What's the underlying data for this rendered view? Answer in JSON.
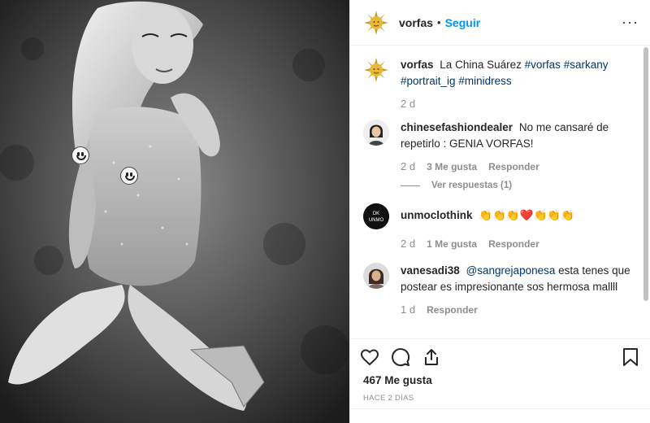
{
  "post": {
    "username": "vorfas",
    "separator": "•",
    "follow_label": "Seguir",
    "more_icon": "more-options-icon"
  },
  "caption": {
    "user": "vorfas",
    "text": "La China Suárez",
    "hashtags": [
      "#vorfas",
      "#sarkany",
      "#portrait_ig",
      "#minidress"
    ],
    "time": "2 d"
  },
  "comments": [
    {
      "user": "chinesefashiondealer",
      "text": "No me cansaré de repetirlo : GENIA VORFAS!",
      "time": "2 d",
      "likes": "3 Me gusta",
      "reply": "Responder",
      "view_replies": "Ver respuestas (1)"
    },
    {
      "user": "unmoclothink",
      "text": "👏👏👏❤️👏👏👏",
      "time": "2 d",
      "likes": "1 Me gusta",
      "reply": "Responder"
    },
    {
      "user": "vanesadi38",
      "mention": "@sangrejaponesa",
      "text": "esta tenes que postear es impresionante sos hermosa mallll",
      "time": "1 d",
      "reply": "Responder"
    }
  ],
  "footer": {
    "likes": "467 Me gusta",
    "date": "HACE 2 DÍAS"
  },
  "colors": {
    "link": "#0095f6",
    "hashtag": "#00376b",
    "muted": "#8e8e8e",
    "heart": "#ed4956"
  }
}
